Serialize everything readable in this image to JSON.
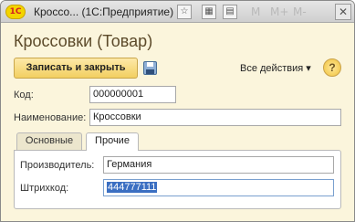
{
  "window": {
    "title": "Кроссо... (1С:Предприятие)",
    "logo_text": "1С",
    "toolbar_memory": [
      "M",
      "M+",
      "M-"
    ],
    "close_symbol": "✕"
  },
  "form": {
    "title": "Кроссовки (Товар)"
  },
  "command_bar": {
    "save_close_label": "Записать и закрыть",
    "all_actions_label": "Все действия ▾",
    "help_symbol": "?"
  },
  "fields": {
    "code_label": "Код:",
    "code_value": "000000001",
    "name_label": "Наименование:",
    "name_value": "Кроссовки"
  },
  "tabs": [
    {
      "label": "Основные",
      "active": false
    },
    {
      "label": "Прочие",
      "active": true
    }
  ],
  "tab_other": {
    "manufacturer_label": "Производитель:",
    "manufacturer_value": "Германия",
    "barcode_label": "Штрихкод:",
    "barcode_value": "444777111"
  }
}
